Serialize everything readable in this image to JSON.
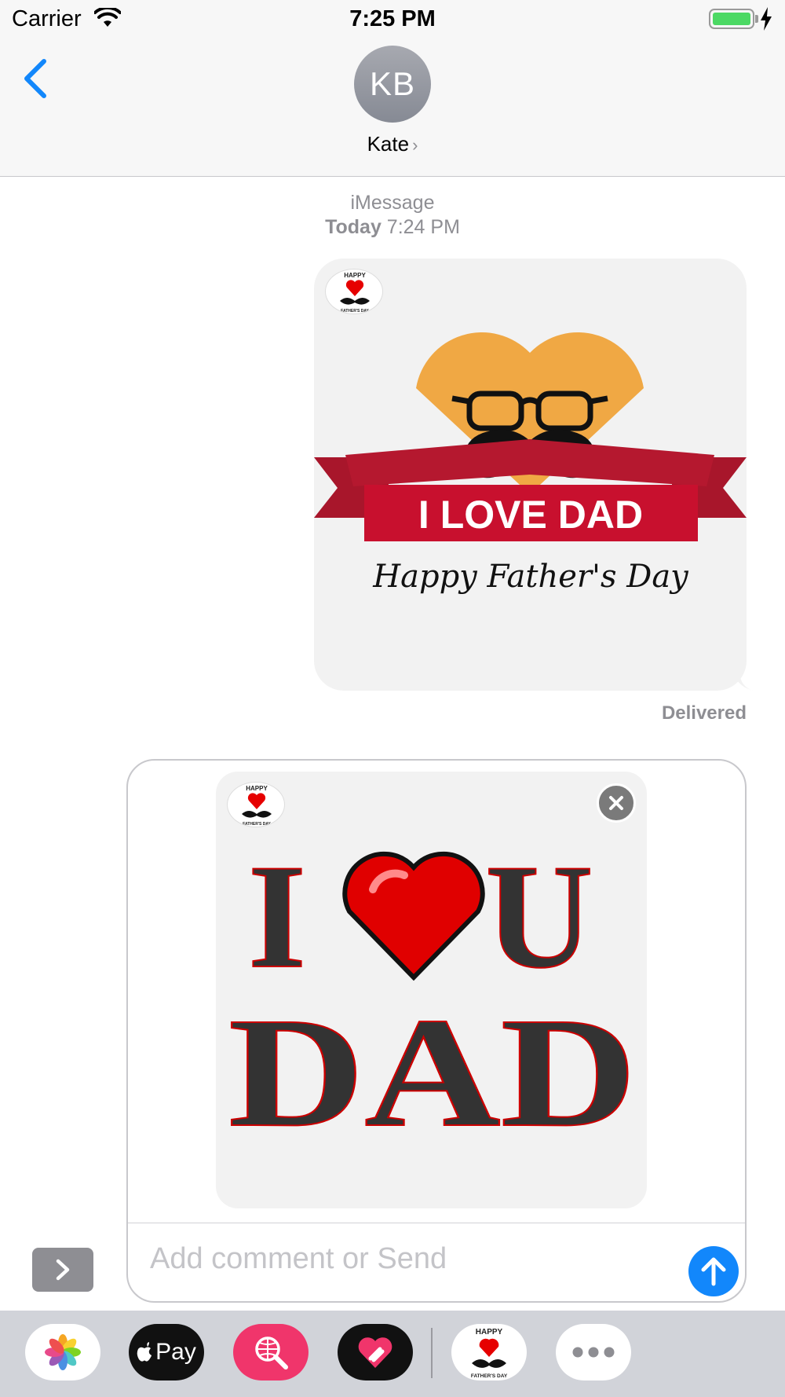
{
  "status_bar": {
    "carrier": "Carrier",
    "time": "7:25 PM"
  },
  "header": {
    "avatar_initials": "KB",
    "contact_name": "Kate"
  },
  "conversation": {
    "service": "iMessage",
    "date_label": "Today",
    "date_time": "7:24 PM"
  },
  "sent_message": {
    "sticker_logo": {
      "line1": "HAPPY",
      "line2": "FATHER'S DAY"
    },
    "banner_text": "I LOVE DAD",
    "script_text": "Happy Father's Day",
    "status": "Delivered"
  },
  "compose": {
    "sticker_logo": {
      "line1": "HAPPY",
      "line2": "FATHER'S DAY"
    },
    "preview_line1_left": "I",
    "preview_line1_right": "U",
    "preview_line2": "DAD",
    "placeholder": "Add comment or Send"
  },
  "app_drawer": {
    "apps": [
      {
        "name": "Photos",
        "icon": "photos-icon"
      },
      {
        "name": "Apple Pay",
        "label": "Pay",
        "icon": "apple-pay-icon"
      },
      {
        "name": "Web Images",
        "icon": "globe-search-icon"
      },
      {
        "name": "Digital Touch",
        "icon": "heart-touch-icon"
      },
      {
        "name": "Happy Father's Day",
        "line1": "HAPPY",
        "line2": "FATHER'S DAY",
        "icon": "fathers-day-sticker-icon"
      },
      {
        "name": "More",
        "icon": "more-icon"
      }
    ]
  },
  "colors": {
    "ios_blue": "#1287fb",
    "battery_green": "#4cd964",
    "heart_orange": "#f0a844",
    "ribbon_red": "#c8102e",
    "heart_red": "#e00000",
    "meta_gray": "#8e8e93"
  }
}
